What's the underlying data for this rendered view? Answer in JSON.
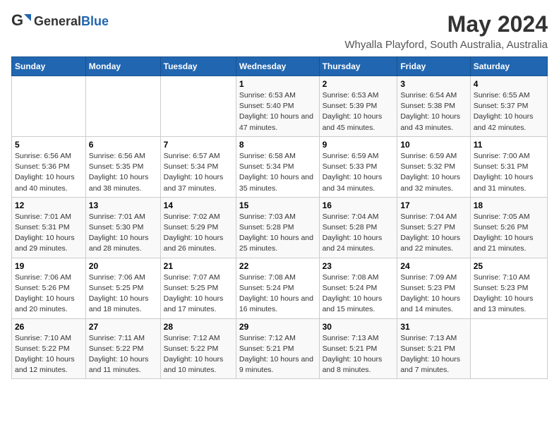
{
  "header": {
    "logo_general": "General",
    "logo_blue": "Blue",
    "title": "May 2024",
    "subtitle": "Whyalla Playford, South Australia, Australia"
  },
  "days_of_week": [
    "Sunday",
    "Monday",
    "Tuesday",
    "Wednesday",
    "Thursday",
    "Friday",
    "Saturday"
  ],
  "weeks": [
    [
      {
        "num": "",
        "sunrise": "",
        "sunset": "",
        "daylight": ""
      },
      {
        "num": "",
        "sunrise": "",
        "sunset": "",
        "daylight": ""
      },
      {
        "num": "",
        "sunrise": "",
        "sunset": "",
        "daylight": ""
      },
      {
        "num": "1",
        "sunrise": "Sunrise: 6:53 AM",
        "sunset": "Sunset: 5:40 PM",
        "daylight": "Daylight: 10 hours and 47 minutes."
      },
      {
        "num": "2",
        "sunrise": "Sunrise: 6:53 AM",
        "sunset": "Sunset: 5:39 PM",
        "daylight": "Daylight: 10 hours and 45 minutes."
      },
      {
        "num": "3",
        "sunrise": "Sunrise: 6:54 AM",
        "sunset": "Sunset: 5:38 PM",
        "daylight": "Daylight: 10 hours and 43 minutes."
      },
      {
        "num": "4",
        "sunrise": "Sunrise: 6:55 AM",
        "sunset": "Sunset: 5:37 PM",
        "daylight": "Daylight: 10 hours and 42 minutes."
      }
    ],
    [
      {
        "num": "5",
        "sunrise": "Sunrise: 6:56 AM",
        "sunset": "Sunset: 5:36 PM",
        "daylight": "Daylight: 10 hours and 40 minutes."
      },
      {
        "num": "6",
        "sunrise": "Sunrise: 6:56 AM",
        "sunset": "Sunset: 5:35 PM",
        "daylight": "Daylight: 10 hours and 38 minutes."
      },
      {
        "num": "7",
        "sunrise": "Sunrise: 6:57 AM",
        "sunset": "Sunset: 5:34 PM",
        "daylight": "Daylight: 10 hours and 37 minutes."
      },
      {
        "num": "8",
        "sunrise": "Sunrise: 6:58 AM",
        "sunset": "Sunset: 5:34 PM",
        "daylight": "Daylight: 10 hours and 35 minutes."
      },
      {
        "num": "9",
        "sunrise": "Sunrise: 6:59 AM",
        "sunset": "Sunset: 5:33 PM",
        "daylight": "Daylight: 10 hours and 34 minutes."
      },
      {
        "num": "10",
        "sunrise": "Sunrise: 6:59 AM",
        "sunset": "Sunset: 5:32 PM",
        "daylight": "Daylight: 10 hours and 32 minutes."
      },
      {
        "num": "11",
        "sunrise": "Sunrise: 7:00 AM",
        "sunset": "Sunset: 5:31 PM",
        "daylight": "Daylight: 10 hours and 31 minutes."
      }
    ],
    [
      {
        "num": "12",
        "sunrise": "Sunrise: 7:01 AM",
        "sunset": "Sunset: 5:31 PM",
        "daylight": "Daylight: 10 hours and 29 minutes."
      },
      {
        "num": "13",
        "sunrise": "Sunrise: 7:01 AM",
        "sunset": "Sunset: 5:30 PM",
        "daylight": "Daylight: 10 hours and 28 minutes."
      },
      {
        "num": "14",
        "sunrise": "Sunrise: 7:02 AM",
        "sunset": "Sunset: 5:29 PM",
        "daylight": "Daylight: 10 hours and 26 minutes."
      },
      {
        "num": "15",
        "sunrise": "Sunrise: 7:03 AM",
        "sunset": "Sunset: 5:28 PM",
        "daylight": "Daylight: 10 hours and 25 minutes."
      },
      {
        "num": "16",
        "sunrise": "Sunrise: 7:04 AM",
        "sunset": "Sunset: 5:28 PM",
        "daylight": "Daylight: 10 hours and 24 minutes."
      },
      {
        "num": "17",
        "sunrise": "Sunrise: 7:04 AM",
        "sunset": "Sunset: 5:27 PM",
        "daylight": "Daylight: 10 hours and 22 minutes."
      },
      {
        "num": "18",
        "sunrise": "Sunrise: 7:05 AM",
        "sunset": "Sunset: 5:26 PM",
        "daylight": "Daylight: 10 hours and 21 minutes."
      }
    ],
    [
      {
        "num": "19",
        "sunrise": "Sunrise: 7:06 AM",
        "sunset": "Sunset: 5:26 PM",
        "daylight": "Daylight: 10 hours and 20 minutes."
      },
      {
        "num": "20",
        "sunrise": "Sunrise: 7:06 AM",
        "sunset": "Sunset: 5:25 PM",
        "daylight": "Daylight: 10 hours and 18 minutes."
      },
      {
        "num": "21",
        "sunrise": "Sunrise: 7:07 AM",
        "sunset": "Sunset: 5:25 PM",
        "daylight": "Daylight: 10 hours and 17 minutes."
      },
      {
        "num": "22",
        "sunrise": "Sunrise: 7:08 AM",
        "sunset": "Sunset: 5:24 PM",
        "daylight": "Daylight: 10 hours and 16 minutes."
      },
      {
        "num": "23",
        "sunrise": "Sunrise: 7:08 AM",
        "sunset": "Sunset: 5:24 PM",
        "daylight": "Daylight: 10 hours and 15 minutes."
      },
      {
        "num": "24",
        "sunrise": "Sunrise: 7:09 AM",
        "sunset": "Sunset: 5:23 PM",
        "daylight": "Daylight: 10 hours and 14 minutes."
      },
      {
        "num": "25",
        "sunrise": "Sunrise: 7:10 AM",
        "sunset": "Sunset: 5:23 PM",
        "daylight": "Daylight: 10 hours and 13 minutes."
      }
    ],
    [
      {
        "num": "26",
        "sunrise": "Sunrise: 7:10 AM",
        "sunset": "Sunset: 5:22 PM",
        "daylight": "Daylight: 10 hours and 12 minutes."
      },
      {
        "num": "27",
        "sunrise": "Sunrise: 7:11 AM",
        "sunset": "Sunset: 5:22 PM",
        "daylight": "Daylight: 10 hours and 11 minutes."
      },
      {
        "num": "28",
        "sunrise": "Sunrise: 7:12 AM",
        "sunset": "Sunset: 5:22 PM",
        "daylight": "Daylight: 10 hours and 10 minutes."
      },
      {
        "num": "29",
        "sunrise": "Sunrise: 7:12 AM",
        "sunset": "Sunset: 5:21 PM",
        "daylight": "Daylight: 10 hours and 9 minutes."
      },
      {
        "num": "30",
        "sunrise": "Sunrise: 7:13 AM",
        "sunset": "Sunset: 5:21 PM",
        "daylight": "Daylight: 10 hours and 8 minutes."
      },
      {
        "num": "31",
        "sunrise": "Sunrise: 7:13 AM",
        "sunset": "Sunset: 5:21 PM",
        "daylight": "Daylight: 10 hours and 7 minutes."
      },
      {
        "num": "",
        "sunrise": "",
        "sunset": "",
        "daylight": ""
      }
    ]
  ]
}
